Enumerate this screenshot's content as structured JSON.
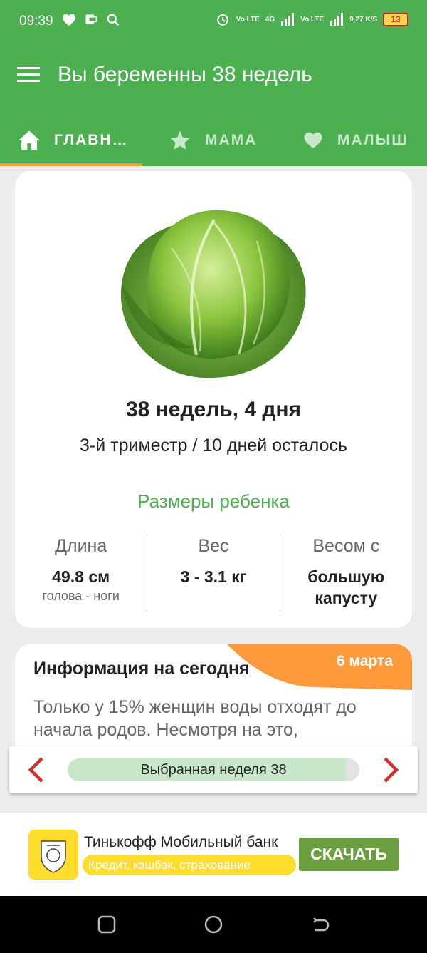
{
  "status_bar": {
    "time": "09:39",
    "right_text": [
      "Vo LTE",
      "4G",
      "Vo LTE",
      "9,27 K/S"
    ],
    "battery": "13",
    "icons": [
      "heart-icon",
      "wallet-icon",
      "search-icon",
      "alarm-icon",
      "signal-icon",
      "battery-icon"
    ]
  },
  "app": {
    "title": "Вы беременны 38 недель",
    "tabs": [
      {
        "label": "ГЛАВН…",
        "icon": "home-icon",
        "active": true
      },
      {
        "label": "МАМА",
        "icon": "star-icon",
        "active": false
      },
      {
        "label": "МАЛЫШ",
        "icon": "heart-icon",
        "active": false
      }
    ]
  },
  "week_card": {
    "image": "cabbage",
    "week_text": "38 недель, 4 дня",
    "trimester_text": "3-й триместр / 10 дней осталось",
    "sizes_title": "Размеры ребенка",
    "stats": [
      {
        "label": "Длина",
        "value": "49.8 см",
        "sub": "голова - ноги"
      },
      {
        "label": "Вес",
        "value": "3 - 3.1 кг",
        "sub": ""
      },
      {
        "label": "Весом с",
        "value": "большую капусту",
        "sub": ""
      }
    ]
  },
  "info_card": {
    "title": "Информация на сегодня",
    "date": "6 марта",
    "text": "Только у 15% женщин воды отходят до начала родов. Несмотря на это,"
  },
  "week_selector": {
    "label": "Выбранная неделя 38",
    "progress": 0.95
  },
  "ad": {
    "title": "Тинькофф Мобильный банк",
    "subtitle": "Кредит, кэшбэк, страхование",
    "button": "СКАЧАТЬ"
  },
  "colors": {
    "primary": "#4caf50",
    "accent": "#ff9a3c",
    "arrow": "#d32f2f",
    "ad_button": "#6a9e3f",
    "ad_yellow": "#ffdd2d"
  }
}
